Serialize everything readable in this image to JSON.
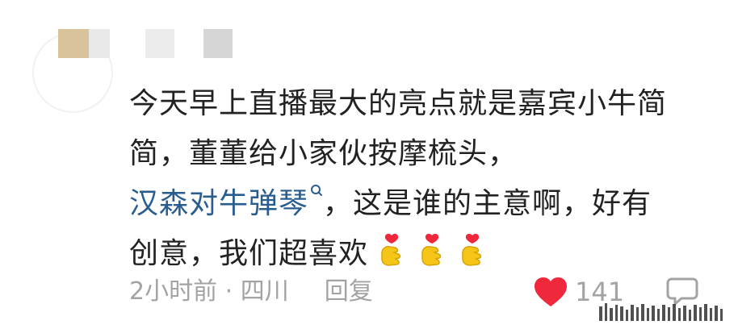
{
  "comment": {
    "lines": [
      "今天早上直播最大的亮点就是嘉宾小牛简",
      "简，董董给小家伙按摩梳头，",
      "，这是谁的主意啊，好有",
      "创意，我们超喜欢"
    ],
    "topic_link": "汉森对牛弹琴"
  },
  "meta": {
    "time_location": "2小时前 · 四川",
    "reply_label": "回复"
  },
  "actions": {
    "like_count": "141"
  },
  "colors": {
    "text": "#222222",
    "link": "#2a5d8f",
    "meta": "#a3a3a3",
    "heart": "#f0283c"
  },
  "icons": {
    "emoji": "heart-hands-emoji",
    "like": "heart-icon",
    "comment": "comment-bubble-icon",
    "search": "search-icon"
  }
}
